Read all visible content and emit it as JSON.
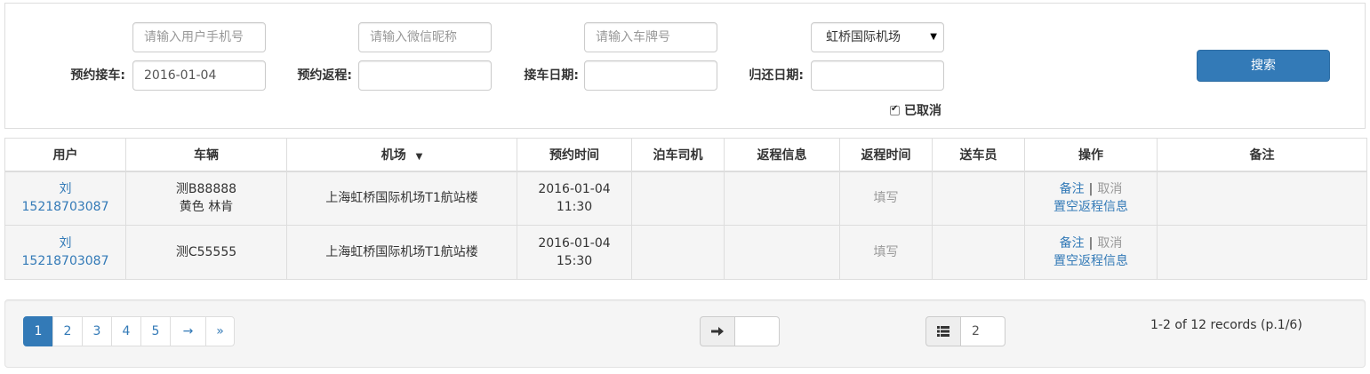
{
  "filters": {
    "phone_placeholder": "请输入用户手机号",
    "wechat_placeholder": "请输入微信昵称",
    "plate_placeholder": "请输入车牌号",
    "airport_selected": "虹桥国际机场",
    "pickup_booking_label": "预约接车:",
    "pickup_booking_value": "2016-01-04",
    "return_booking_label": "预约返程:",
    "return_booking_value": "",
    "pickup_date_label": "接车日期:",
    "pickup_date_value": "",
    "return_date_label": "归还日期:",
    "return_date_value": "",
    "cancelled_label": "已取消",
    "cancelled_checked": true,
    "search_label": "搜索"
  },
  "table": {
    "headers": [
      "用户",
      "车辆",
      "机场",
      "预约时间",
      "泊车司机",
      "返程信息",
      "返程时间",
      "送车员",
      "操作",
      "备注"
    ],
    "sort_indicator": "▼",
    "rows": [
      {
        "user_name": "刘",
        "user_phone": "15218703087",
        "vehicle_line1": "测B88888",
        "vehicle_line2": "黄色 林肯",
        "airport": "上海虹桥国际机场T1航站楼",
        "time_date": "2016-01-04",
        "time_clock": "11:30",
        "driver": "",
        "return_info": "",
        "return_time": "填写",
        "deliverer": "",
        "action_note": "备注",
        "action_sep": "|",
        "action_cancel": "取消",
        "action_clear": "置空返程信息",
        "remark": ""
      },
      {
        "user_name": "刘",
        "user_phone": "15218703087",
        "vehicle_line1": "测C55555",
        "vehicle_line2": "",
        "airport": "上海虹桥国际机场T1航站楼",
        "time_date": "2016-01-04",
        "time_clock": "15:30",
        "driver": "",
        "return_info": "",
        "return_time": "填写",
        "deliverer": "",
        "action_note": "备注",
        "action_sep": "|",
        "action_cancel": "取消",
        "action_clear": "置空返程信息",
        "remark": ""
      }
    ]
  },
  "pager": {
    "pages": [
      "1",
      "2",
      "3",
      "4",
      "5"
    ],
    "next": "→",
    "last": "»",
    "current": 1,
    "jump_value": "",
    "page_size": "2",
    "summary": "1-2 of 12 records (p.1/6)"
  },
  "colors": {
    "primary": "#337ab7",
    "muted": "#999999"
  }
}
